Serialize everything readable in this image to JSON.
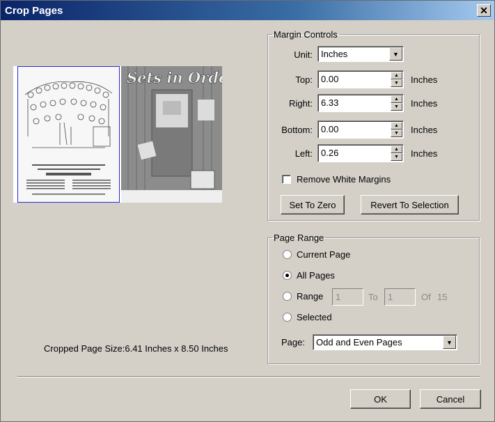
{
  "window": {
    "title": "Crop Pages",
    "close_glyph": "✕"
  },
  "preview": {
    "page1_header": "STUDENT DANCERS... SCHOOLS... COLLEGES",
    "page1_sub": "SET BOX BUSY TEACH YOU SQUARE DANCING",
    "page2_title": "Sets in Order"
  },
  "cropped_size": "Cropped Page Size:6.41 Inches x 8.50 Inches",
  "margin_controls": {
    "legend": "Margin Controls",
    "unit_label": "Unit:",
    "unit_value": "Inches",
    "top_label": "Top:",
    "top_value": "0.00",
    "right_label": "Right:",
    "right_value": "6.33",
    "bottom_label": "Bottom:",
    "bottom_value": "0.00",
    "left_label": "Left:",
    "left_value": "0.26",
    "unit_suffix": "Inches",
    "remove_white_label": "Remove White Margins",
    "set_to_zero_label": "Set To Zero",
    "revert_label": "Revert To Selection"
  },
  "page_range": {
    "legend": "Page Range",
    "current_label": "Current Page",
    "all_label": "All Pages",
    "range_label": "Range",
    "range_from": "1",
    "to_label": "To",
    "range_to": "1",
    "of_label": "Of",
    "of_total": "15",
    "selected_label": "Selected",
    "page_label": "Page:",
    "page_value": "Odd and Even Pages",
    "selected_option": "all"
  },
  "footer": {
    "ok_label": "OK",
    "cancel_label": "Cancel"
  },
  "colors": {
    "titlebar": "#0a246a",
    "dialog_bg": "#d4d0c8",
    "selection_border": "#2a2ad0"
  }
}
